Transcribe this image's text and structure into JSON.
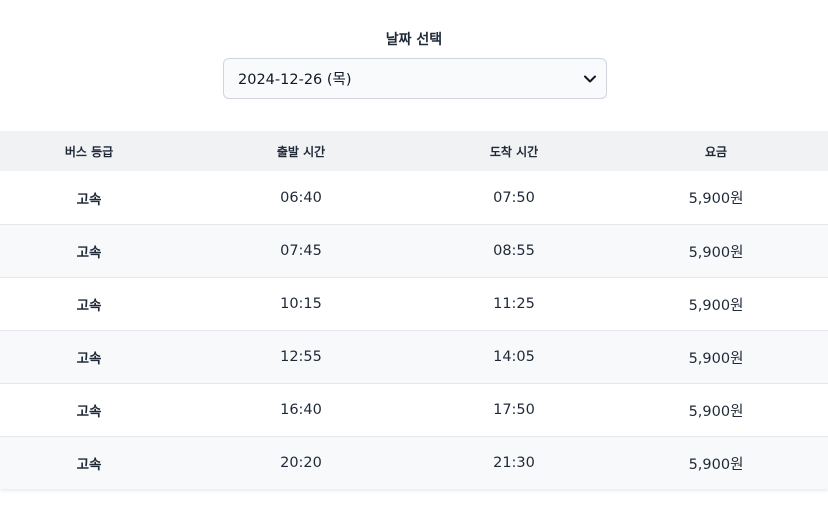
{
  "date_picker": {
    "label": "날짜 선택",
    "selected": "2024-12-26 (목)"
  },
  "table": {
    "headers": {
      "grade": "버스 등급",
      "departure": "출발 시간",
      "arrival": "도착 시간",
      "fare": "요금"
    },
    "rows": [
      {
        "grade": "고속",
        "departure": "06:40",
        "arrival": "07:50",
        "fare": "5,900원"
      },
      {
        "grade": "고속",
        "departure": "07:45",
        "arrival": "08:55",
        "fare": "5,900원"
      },
      {
        "grade": "고속",
        "departure": "10:15",
        "arrival": "11:25",
        "fare": "5,900원"
      },
      {
        "grade": "고속",
        "departure": "12:55",
        "arrival": "14:05",
        "fare": "5,900원"
      },
      {
        "grade": "고속",
        "departure": "16:40",
        "arrival": "17:50",
        "fare": "5,900원"
      },
      {
        "grade": "고속",
        "departure": "20:20",
        "arrival": "21:30",
        "fare": "5,900원"
      }
    ]
  }
}
